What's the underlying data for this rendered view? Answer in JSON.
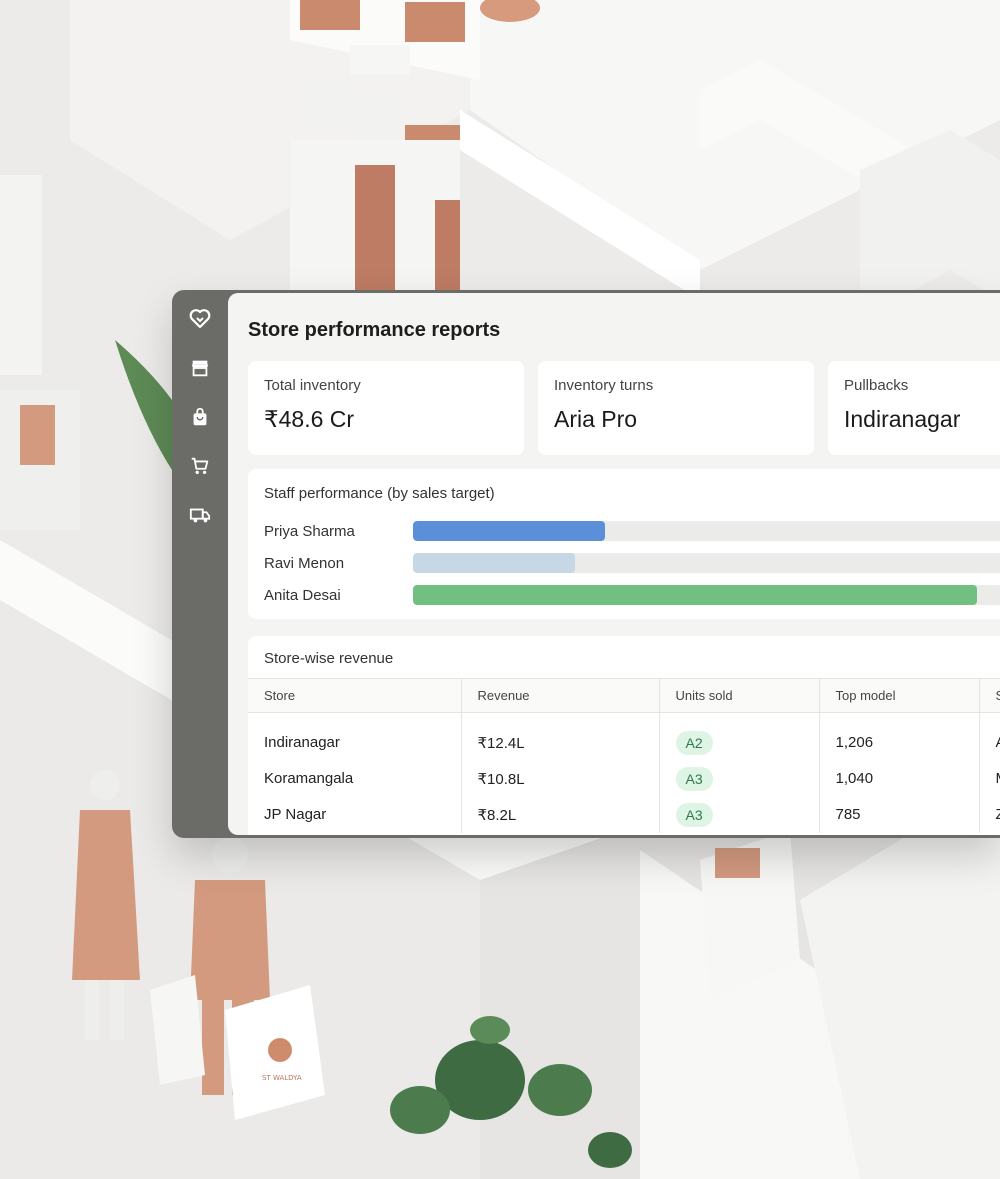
{
  "page": {
    "title": "Store performance reports"
  },
  "sidebar": {
    "items": [
      {
        "icon": "logo-heart-icon"
      },
      {
        "icon": "storefront-icon"
      },
      {
        "icon": "shopping-bag-icon"
      },
      {
        "icon": "cart-icon"
      },
      {
        "icon": "delivery-truck-icon"
      }
    ]
  },
  "kpis": [
    {
      "label": "Total inventory",
      "value": "₹48.6 Cr"
    },
    {
      "label": "Inventory turns",
      "value": "Aria Pro"
    },
    {
      "label": "Pullbacks",
      "value": "Indiranagar"
    }
  ],
  "staff": {
    "title": "Staff performance (by sales target)",
    "rows": [
      {
        "name": "Priya Sharma",
        "progress": 0.32,
        "color": "#5b8fd8"
      },
      {
        "name": "Ravi Menon",
        "progress": 0.27,
        "color": "#c6d7e6"
      },
      {
        "name": "Anita Desai",
        "progress": 0.94,
        "color": "#72bf82"
      }
    ]
  },
  "revenue": {
    "title": "Store-wise revenue",
    "columns": [
      "Store",
      "Revenue",
      "Units sold",
      "Top model",
      "S"
    ],
    "rows": [
      {
        "store": "Indiranagar",
        "revenue": "₹12.4L",
        "units": "A2",
        "top": "1,206",
        "extra": "A"
      },
      {
        "store": "Koramangala",
        "revenue": "₹10.8L",
        "units": "A3",
        "top": "1,040",
        "extra": "M"
      },
      {
        "store": "JP Nagar",
        "revenue": "₹8.2L",
        "units": "A3",
        "top": "785",
        "extra": "Z"
      }
    ]
  },
  "illustration": {
    "bag_logo_text": "ST WALDYA"
  },
  "colors": {
    "accent_blue": "#5b8fd8",
    "accent_green": "#72bf82",
    "badge_green_bg": "#def4e4",
    "rail": "#6b6b68"
  }
}
